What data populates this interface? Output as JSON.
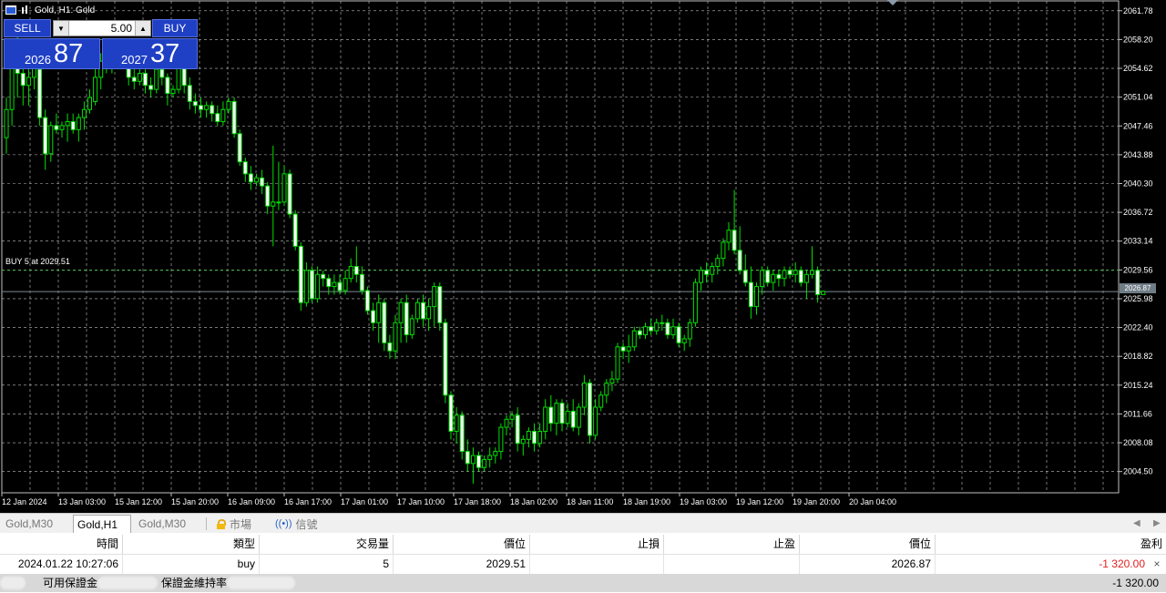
{
  "chart": {
    "title": "Gold, H1:  Gold",
    "lot_value": "5.00",
    "sell_label": "SELL",
    "buy_label": "BUY",
    "sell_price_small": "2026",
    "sell_price_big": "87",
    "buy_price_small": "2027",
    "buy_price_big": "37",
    "position_label": "BUY 5 at 2029.51",
    "current_price": "2026.87",
    "lot_dec_icon": "arrow-down-icon",
    "lot_inc_icon": "arrow-up-icon",
    "colors": {
      "background": "#000000",
      "grid": "#c0c0c0",
      "candle": "#00e000",
      "up_body": "#000000",
      "down_body": "#ffffff",
      "panel_blue": "#1f3fc4"
    }
  },
  "chart_data": {
    "type": "candlestick",
    "title": "Gold, H1:  Gold",
    "y_ticks": [
      "2061.78",
      "2058.20",
      "2054.62",
      "2051.04",
      "2047.46",
      "2043.88",
      "2040.30",
      "2036.72",
      "2033.14",
      "2029.56",
      "2025.98",
      "2022.40",
      "2018.82",
      "2015.24",
      "2011.66",
      "2008.08",
      "2004.50"
    ],
    "ylim": [
      2001.86,
      2063.0
    ],
    "x_ticks": [
      "12 Jan 2024",
      "13 Jan 03:00",
      "15 Jan 12:00",
      "15 Jan 20:00",
      "16 Jan 09:00",
      "16 Jan 17:00",
      "17 Jan 01:00",
      "17 Jan 10:00",
      "17 Jan 18:00",
      "18 Jan 02:00",
      "18 Jan 11:00",
      "18 Jan 19:00",
      "19 Jan 03:00",
      "19 Jan 12:00",
      "19 Jan 20:00",
      "20 Jan 04:00"
    ],
    "grid": true,
    "position_line": 2029.51,
    "bid_line": 2026.87,
    "candles": [
      [
        2046.0,
        2051.0,
        2044.0,
        2049.5
      ],
      [
        2049.5,
        2057.0,
        2047.5,
        2055.0
      ],
      [
        2055.0,
        2059.5,
        2051.0,
        2054.0
      ],
      [
        2054.0,
        2057.0,
        2050.0,
        2052.5
      ],
      [
        2052.5,
        2055.5,
        2050.0,
        2053.5
      ],
      [
        2053.5,
        2056.0,
        2052.0,
        2055.0
      ],
      [
        2054.5,
        2055.0,
        2047.5,
        2048.5
      ],
      [
        2048.5,
        2049.5,
        2042.0,
        2044.0
      ],
      [
        2044.0,
        2048.0,
        2043.0,
        2047.5
      ],
      [
        2047.5,
        2049.0,
        2046.5,
        2047.0
      ],
      [
        2047.0,
        2048.0,
        2046.0,
        2047.5
      ],
      [
        2047.5,
        2049.0,
        2045.5,
        2048.0
      ],
      [
        2048.0,
        2049.0,
        2046.5,
        2047.0
      ],
      [
        2047.0,
        2049.0,
        2045.5,
        2048.5
      ],
      [
        2048.5,
        2050.5,
        2047.0,
        2049.5
      ],
      [
        2049.5,
        2052.0,
        2049.0,
        2051.0
      ],
      [
        2050.5,
        2054.5,
        2050.0,
        2053.5
      ],
      [
        2053.5,
        2056.5,
        2052.0,
        2055.5
      ],
      [
        2055.5,
        2058.0,
        2054.0,
        2056.5
      ],
      [
        2056.5,
        2057.5,
        2054.0,
        2055.0
      ],
      [
        2055.0,
        2057.5,
        2054.5,
        2056.5
      ],
      [
        2056.5,
        2058.0,
        2054.5,
        2055.5
      ],
      [
        2055.5,
        2057.0,
        2052.5,
        2053.5
      ],
      [
        2053.5,
        2054.5,
        2052.0,
        2053.0
      ],
      [
        2053.0,
        2054.5,
        2052.5,
        2054.0
      ],
      [
        2054.0,
        2054.5,
        2051.5,
        2052.5
      ],
      [
        2052.5,
        2053.5,
        2051.0,
        2052.0
      ],
      [
        2052.0,
        2055.0,
        2051.5,
        2054.5
      ],
      [
        2054.5,
        2055.5,
        2052.5,
        2053.5
      ],
      [
        2053.5,
        2054.0,
        2050.0,
        2051.5
      ],
      [
        2051.5,
        2052.5,
        2051.0,
        2052.0
      ],
      [
        2052.0,
        2056.0,
        2051.5,
        2055.0
      ],
      [
        2055.0,
        2056.5,
        2051.5,
        2052.5
      ],
      [
        2052.5,
        2053.5,
        2049.5,
        2050.5
      ],
      [
        2050.5,
        2051.5,
        2049.0,
        2050.0
      ],
      [
        2050.0,
        2051.0,
        2048.5,
        2049.5
      ],
      [
        2049.5,
        2050.5,
        2048.5,
        2050.0
      ],
      [
        2050.0,
        2050.5,
        2048.0,
        2049.0
      ],
      [
        2049.0,
        2050.0,
        2047.5,
        2048.0
      ],
      [
        2048.0,
        2050.5,
        2047.5,
        2049.5
      ],
      [
        2049.5,
        2051.0,
        2049.0,
        2050.5
      ],
      [
        2050.5,
        2051.0,
        2046.0,
        2046.5
      ],
      [
        2046.5,
        2047.0,
        2042.5,
        2043.0
      ],
      [
        2043.0,
        2043.5,
        2040.5,
        2041.5
      ],
      [
        2041.5,
        2042.5,
        2039.5,
        2040.5
      ],
      [
        2040.5,
        2041.5,
        2040.0,
        2041.0
      ],
      [
        2041.0,
        2042.0,
        2039.0,
        2040.0
      ],
      [
        2040.0,
        2040.5,
        2036.5,
        2037.5
      ],
      [
        2037.5,
        2045.0,
        2032.5,
        2038.0
      ],
      [
        2038.0,
        2043.0,
        2037.0,
        2038.0
      ],
      [
        2038.0,
        2042.5,
        2037.5,
        2041.5
      ],
      [
        2041.5,
        2042.0,
        2036.0,
        2036.5
      ],
      [
        2036.5,
        2037.0,
        2032.0,
        2032.5
      ],
      [
        2032.5,
        2033.0,
        2024.5,
        2025.5
      ],
      [
        2025.5,
        2030.5,
        2025.0,
        2029.5
      ],
      [
        2029.5,
        2030.0,
        2025.5,
        2026.0
      ],
      [
        2026.0,
        2030.0,
        2025.5,
        2029.0
      ],
      [
        2029.0,
        2029.5,
        2027.5,
        2028.5
      ],
      [
        2028.5,
        2029.0,
        2026.5,
        2027.5
      ],
      [
        2027.5,
        2029.0,
        2026.5,
        2028.0
      ],
      [
        2028.0,
        2029.0,
        2026.5,
        2027.0
      ],
      [
        2027.0,
        2029.5,
        2026.5,
        2028.5
      ],
      [
        2028.5,
        2031.0,
        2028.0,
        2030.0
      ],
      [
        2030.0,
        2032.5,
        2028.0,
        2029.0
      ],
      [
        2029.0,
        2030.0,
        2026.5,
        2027.0
      ],
      [
        2027.0,
        2027.5,
        2024.0,
        2024.5
      ],
      [
        2024.5,
        2025.5,
        2022.0,
        2023.0
      ],
      [
        2023.0,
        2026.5,
        2020.5,
        2025.5
      ],
      [
        2025.5,
        2026.0,
        2019.5,
        2020.5
      ],
      [
        2020.5,
        2021.5,
        2018.5,
        2019.5
      ],
      [
        2019.5,
        2024.0,
        2018.5,
        2023.0
      ],
      [
        2023.0,
        2026.0,
        2020.5,
        2025.5
      ],
      [
        2025.5,
        2026.5,
        2020.5,
        2021.5
      ],
      [
        2021.5,
        2024.0,
        2021.0,
        2023.5
      ],
      [
        2023.5,
        2026.0,
        2023.0,
        2025.5
      ],
      [
        2025.5,
        2026.5,
        2022.5,
        2023.5
      ],
      [
        2023.5,
        2026.0,
        2022.0,
        2025.0
      ],
      [
        2025.0,
        2028.0,
        2022.5,
        2027.5
      ],
      [
        2027.5,
        2028.0,
        2022.0,
        2023.0
      ],
      [
        2023.0,
        2023.5,
        2013.0,
        2014.0
      ],
      [
        2014.0,
        2014.5,
        2008.5,
        2009.5
      ],
      [
        2009.5,
        2012.5,
        2008.0,
        2011.5
      ],
      [
        2011.5,
        2012.0,
        2006.0,
        2007.0
      ],
      [
        2007.0,
        2008.5,
        2004.5,
        2005.5
      ],
      [
        2005.5,
        2007.5,
        2003.0,
        2006.5
      ],
      [
        2006.5,
        2007.0,
        2004.5,
        2005.0
      ],
      [
        2005.0,
        2006.5,
        2004.5,
        2006.0
      ],
      [
        2006.0,
        2007.5,
        2005.0,
        2006.5
      ],
      [
        2006.5,
        2007.5,
        2005.5,
        2007.0
      ],
      [
        2007.0,
        2010.5,
        2006.0,
        2010.0
      ],
      [
        2010.0,
        2011.5,
        2009.0,
        2011.0
      ],
      [
        2011.0,
        2012.0,
        2010.0,
        2011.5
      ],
      [
        2011.5,
        2012.5,
        2007.0,
        2008.0
      ],
      [
        2008.0,
        2009.0,
        2006.5,
        2008.5
      ],
      [
        2008.5,
        2010.0,
        2007.5,
        2009.5
      ],
      [
        2009.5,
        2010.5,
        2007.0,
        2008.0
      ],
      [
        2008.0,
        2010.5,
        2007.5,
        2009.5
      ],
      [
        2009.5,
        2013.5,
        2008.5,
        2012.5
      ],
      [
        2012.5,
        2014.0,
        2009.5,
        2010.5
      ],
      [
        2010.5,
        2013.5,
        2009.0,
        2013.0
      ],
      [
        2013.0,
        2013.5,
        2009.5,
        2010.5
      ],
      [
        2010.5,
        2013.0,
        2010.0,
        2012.0
      ],
      [
        2012.0,
        2013.5,
        2009.5,
        2010.0
      ],
      [
        2010.0,
        2013.0,
        2009.0,
        2012.5
      ],
      [
        2012.5,
        2016.5,
        2011.5,
        2015.5
      ],
      [
        2015.5,
        2016.0,
        2008.0,
        2009.0
      ],
      [
        2009.0,
        2013.5,
        2008.5,
        2012.5
      ],
      [
        2012.5,
        2014.5,
        2012.0,
        2014.0
      ],
      [
        2014.0,
        2016.0,
        2013.0,
        2015.5
      ],
      [
        2015.5,
        2017.0,
        2014.5,
        2016.0
      ],
      [
        2016.0,
        2020.5,
        2015.5,
        2020.0
      ],
      [
        2020.0,
        2020.5,
        2018.5,
        2019.5
      ],
      [
        2019.5,
        2021.5,
        2018.0,
        2020.0
      ],
      [
        2020.0,
        2022.5,
        2019.5,
        2022.0
      ],
      [
        2022.0,
        2022.5,
        2021.0,
        2021.5
      ],
      [
        2021.5,
        2023.0,
        2021.0,
        2022.5
      ],
      [
        2022.5,
        2023.5,
        2021.5,
        2022.0
      ],
      [
        2022.0,
        2023.5,
        2021.5,
        2023.0
      ],
      [
        2023.0,
        2024.0,
        2022.0,
        2023.0
      ],
      [
        2023.0,
        2023.5,
        2021.0,
        2021.5
      ],
      [
        2021.5,
        2023.5,
        2021.0,
        2022.5
      ],
      [
        2022.5,
        2023.0,
        2020.0,
        2020.5
      ],
      [
        2020.5,
        2021.5,
        2019.5,
        2021.0
      ],
      [
        2021.0,
        2023.5,
        2020.0,
        2023.0
      ],
      [
        2023.0,
        2028.5,
        2022.5,
        2028.0
      ],
      [
        2028.0,
        2030.0,
        2027.0,
        2029.5
      ],
      [
        2029.5,
        2030.5,
        2028.0,
        2029.0
      ],
      [
        2029.0,
        2030.5,
        2028.0,
        2030.0
      ],
      [
        2030.0,
        2031.5,
        2029.0,
        2031.0
      ],
      [
        2031.0,
        2033.5,
        2030.0,
        2033.0
      ],
      [
        2033.0,
        2035.5,
        2032.0,
        2034.5
      ],
      [
        2034.5,
        2039.5,
        2031.5,
        2032.0
      ],
      [
        2032.0,
        2035.0,
        2029.0,
        2029.5
      ],
      [
        2029.5,
        2031.5,
        2027.5,
        2028.0
      ],
      [
        2028.0,
        2030.0,
        2023.5,
        2025.0
      ],
      [
        2025.0,
        2028.0,
        2024.0,
        2027.5
      ],
      [
        2027.5,
        2030.0,
        2026.5,
        2029.5
      ],
      [
        2029.5,
        2030.0,
        2027.5,
        2028.0
      ],
      [
        2028.0,
        2029.5,
        2027.0,
        2029.0
      ],
      [
        2029.0,
        2029.5,
        2027.5,
        2028.5
      ],
      [
        2028.5,
        2030.0,
        2027.5,
        2029.5
      ],
      [
        2029.5,
        2030.0,
        2028.5,
        2029.0
      ],
      [
        2029.0,
        2030.5,
        2028.0,
        2029.5
      ],
      [
        2029.5,
        2030.0,
        2027.5,
        2028.0
      ],
      [
        2028.0,
        2029.5,
        2026.0,
        2029.0
      ],
      [
        2029.0,
        2032.5,
        2028.5,
        2029.5
      ],
      [
        2029.5,
        2030.0,
        2025.5,
        2026.5
      ],
      [
        2026.5,
        2027.0,
        2026.5,
        2026.9
      ]
    ]
  },
  "tabs": [
    {
      "label": "Gold,M30"
    },
    {
      "label": "Gold,H1"
    },
    {
      "label": "Gold,M30"
    },
    {
      "label": "市場",
      "icon": "lock-icon"
    },
    {
      "label": "信號",
      "icon": "signal-icon"
    }
  ],
  "trades": {
    "headers": [
      "時間",
      "類型",
      "交易量",
      "價位",
      "止損",
      "止盈",
      "價位",
      "盈利"
    ],
    "row": {
      "time": "2024.01.22 10:27:06",
      "type": "buy",
      "volume": "5",
      "open_price": "2029.51",
      "sl": "",
      "tp": "",
      "current_price": "2026.87",
      "profit": "-1 320.00",
      "profit_color": "#e02020"
    },
    "close_label": "×",
    "summary": {
      "free_margin_label": "可用保證金",
      "margin_level_label": "保證金維持率",
      "total_profit": "-1 320.00"
    }
  }
}
